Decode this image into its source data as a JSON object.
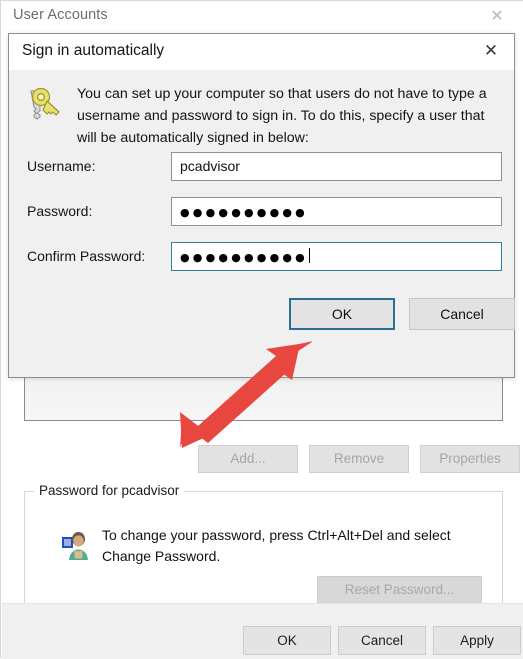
{
  "background_window": {
    "title": "User Accounts",
    "close_icon": "close-icon",
    "buttons": {
      "add": "Add...",
      "remove": "Remove",
      "properties": "Properties"
    },
    "password_group": {
      "legend": "Password for pcadvisor",
      "icon": "user-avatar-icon",
      "text": "To change your password, press Ctrl+Alt+Del and select Change Password.",
      "reset_button": "Reset Password..."
    },
    "footer": {
      "ok": "OK",
      "cancel": "Cancel",
      "apply": "Apply"
    }
  },
  "dialog": {
    "title": "Sign in automatically",
    "close_icon": "close-icon",
    "icon": "key-icon",
    "description": "You can set up your computer so that users do not have to type a username and password to sign in. To do this, specify a user that will be automatically signed in below:",
    "fields": [
      {
        "label": "Username:",
        "value": "pcadvisor",
        "type": "text",
        "focused": false
      },
      {
        "label": "Password:",
        "value": "●●●●●●●●●●",
        "type": "password",
        "focused": false
      },
      {
        "label": "Confirm Password:",
        "value": "●●●●●●●●●●",
        "type": "password",
        "focused": true
      }
    ],
    "buttons": {
      "ok": "OK",
      "cancel": "Cancel"
    }
  },
  "annotation": {
    "arrow_color": "#e8473f",
    "points_at": "OK"
  }
}
